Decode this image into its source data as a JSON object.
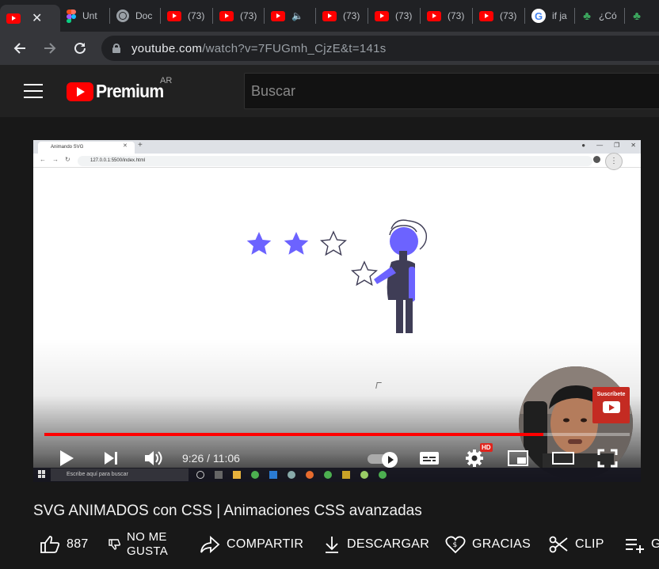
{
  "browser": {
    "tabs": [
      {
        "icon": "youtube-icon",
        "title": "",
        "active": true
      },
      {
        "icon": "figma-icon",
        "title": "Unt"
      },
      {
        "icon": "globe-icon",
        "title": "Doc"
      },
      {
        "icon": "youtube-icon",
        "title": "(73)"
      },
      {
        "icon": "youtube-icon",
        "title": "(73)"
      },
      {
        "icon": "youtube-icon",
        "title": ""
      },
      {
        "icon": "youtube-icon",
        "title": "(73)"
      },
      {
        "icon": "youtube-icon",
        "title": "(73)"
      },
      {
        "icon": "youtube-icon",
        "title": "(73)"
      },
      {
        "icon": "youtube-icon",
        "title": "(73)"
      },
      {
        "icon": "google-icon",
        "title": "if ja"
      },
      {
        "icon": "plant-icon",
        "title": "¿Có"
      },
      {
        "icon": "plant-icon",
        "title": ""
      }
    ],
    "url_host": "youtube.com",
    "url_path": "/watch?v=7FUGmh_CjzE&t=141s"
  },
  "masthead": {
    "logo_text": "Premium",
    "region": "AR",
    "search_placeholder": "Buscar"
  },
  "video_frame": {
    "inner_tab_title": "Animando SVG",
    "inner_url": "127.0.0.1:5500/index.html",
    "subscribe_label": "Suscríbete",
    "taskbar_search": "Escribe aquí para buscar",
    "stars_filled": 2,
    "stars_total": 3
  },
  "player": {
    "progress": 0.853,
    "time_current": "9:26",
    "time_separator": "/",
    "time_total": "11:06",
    "hd_label": "HD",
    "colors": {
      "progress": "#ff0000",
      "star": "#6c63ff"
    }
  },
  "video": {
    "title": "SVG ANIMADOS con CSS | Animaciones CSS avanzadas"
  },
  "actions": {
    "likes": "887",
    "dislike_line1": "NO ME",
    "dislike_line2": "GUSTA",
    "share": "COMPARTIR",
    "download": "DESCARGAR",
    "thanks": "GRACIAS",
    "clip": "CLIP",
    "save": "G"
  }
}
